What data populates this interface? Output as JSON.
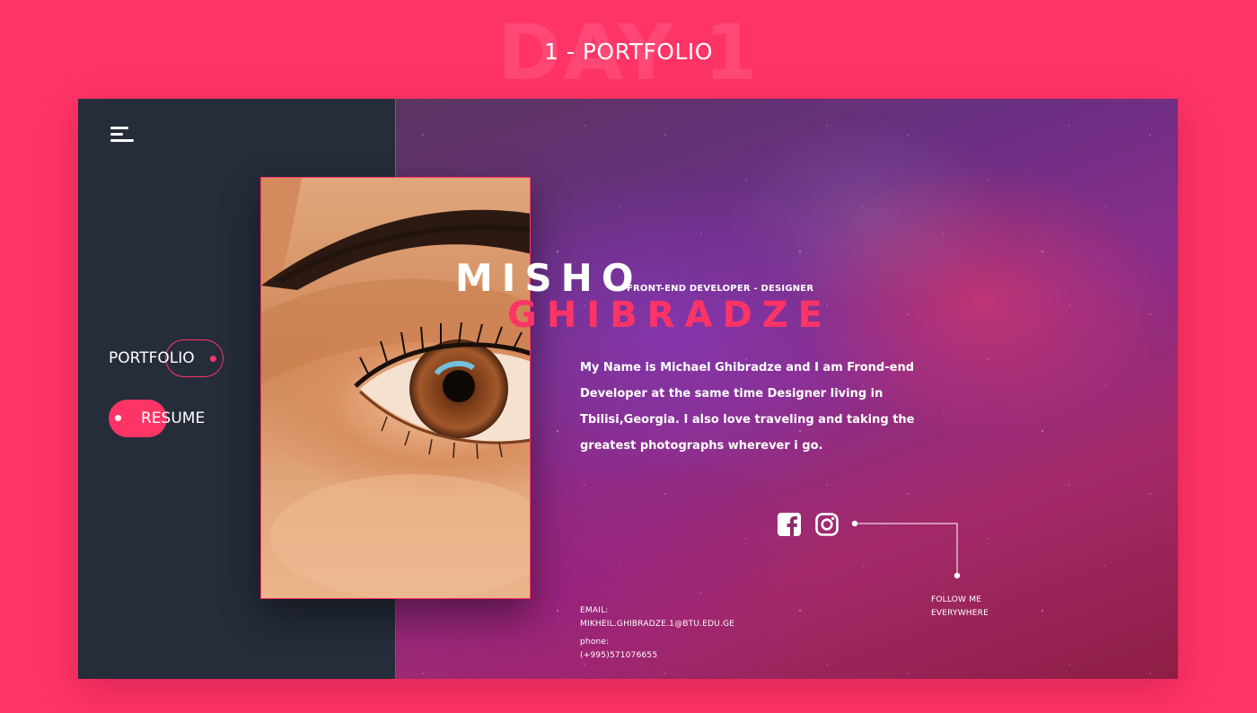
{
  "header": {
    "background_word": "DAY 1",
    "title": "1 - PORTFOLIO"
  },
  "colors": {
    "accent": "#ff3466",
    "sidebar": "#252d3a",
    "text": "#ffffff"
  },
  "sidebar": {
    "menu_icon": "hamburger-menu-icon",
    "nav": [
      {
        "label": "PORTFOLIO",
        "state": "outlined"
      },
      {
        "label": "RESUME",
        "state": "active"
      }
    ]
  },
  "profile": {
    "first_name": "MISHO",
    "last_name": "GHIBRADZE",
    "role": "FRONT-END DEVELOPER - DESIGNER",
    "bio": "My Name is Michael Ghibradze and I am Frond-end Developer at the same time Designer living in Tbilisi,Georgia. I also love traveling and  taking the greatest photographs wherever i go."
  },
  "social": {
    "icons": [
      "facebook-icon",
      "instagram-icon"
    ],
    "caption_line1": "FOLLOW ME",
    "caption_line2": "EVERYWHERE"
  },
  "contact": {
    "email_label": "EMAIL:",
    "email": "MIKHEIL.GHIBRADZE.1@BTU.EDU.GE",
    "phone_label": "phone:",
    "phone": "(+995)571076655"
  }
}
